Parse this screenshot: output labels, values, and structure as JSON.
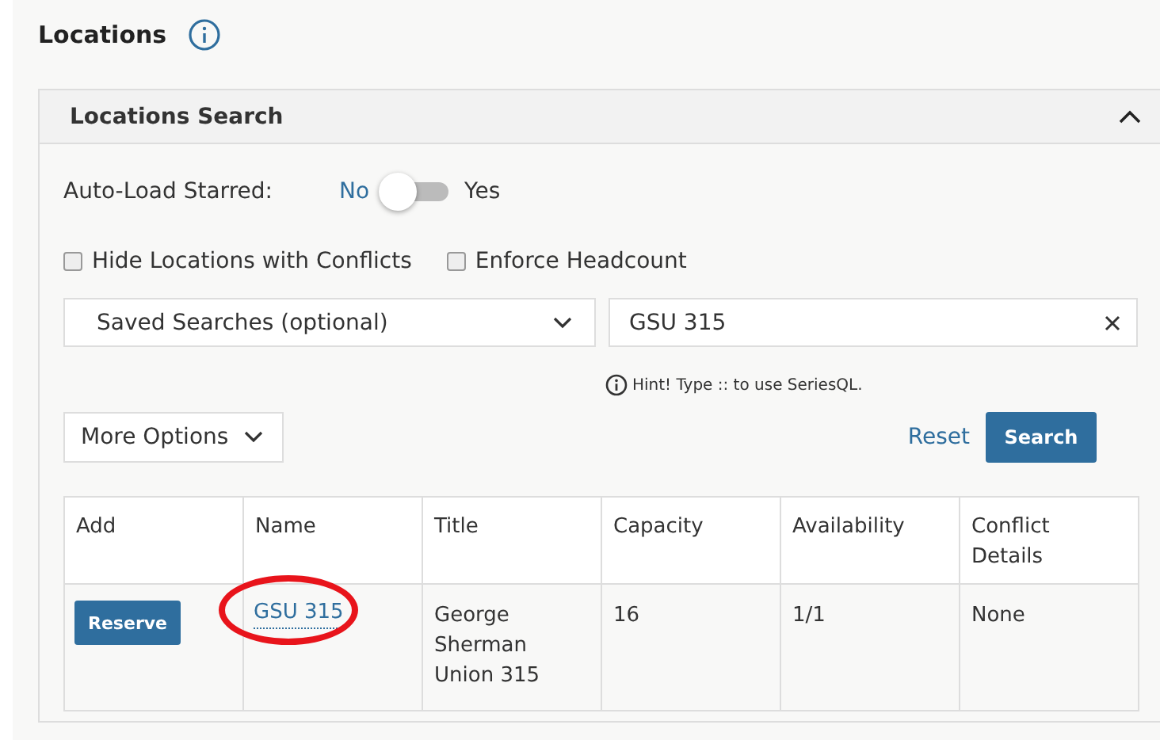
{
  "page": {
    "title": "Locations"
  },
  "search_panel": {
    "title": "Locations Search",
    "expanded": true,
    "auto_load": {
      "label": "Auto-Load Starred:",
      "off_label": "No",
      "on_label": "Yes",
      "on": false
    },
    "checkboxes": [
      {
        "label": "Hide Locations with Conflicts",
        "checked": false
      },
      {
        "label": "Enforce Headcount",
        "checked": false
      }
    ],
    "saved_searches": {
      "value": "Saved Searches (optional)"
    },
    "search_field": {
      "value": "GSU 315"
    },
    "hint": "Hint! Type :: to use SeriesQL.",
    "more_options": "More Options",
    "reset": "Reset",
    "search": "Search"
  },
  "table": {
    "columns": [
      "Add",
      "Name",
      "Title",
      "Capacity",
      "Availability",
      "Conflict Details"
    ],
    "rows": [
      {
        "action": "Reserve",
        "name": "GSU 315",
        "name_circled": true,
        "title": "George Sherman Union 315",
        "capacity": "16",
        "availability": "1/1",
        "conflict": "None"
      }
    ]
  }
}
